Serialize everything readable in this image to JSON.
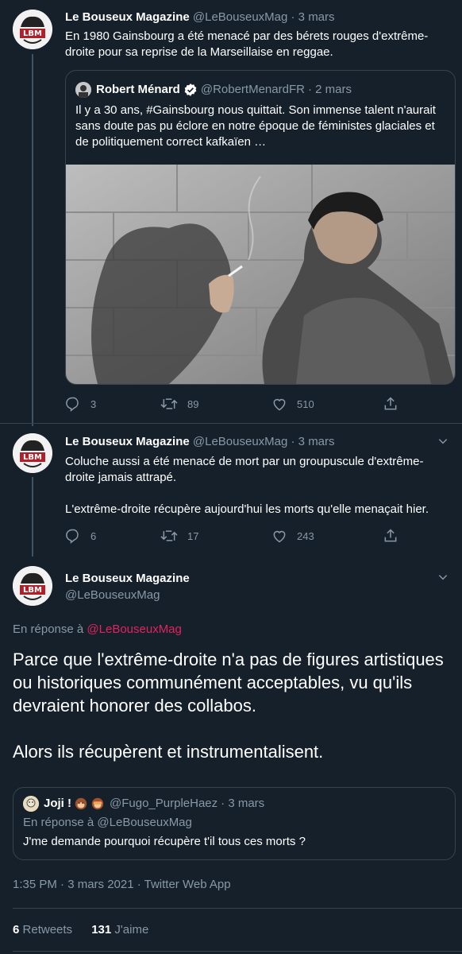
{
  "tweet1": {
    "name": "Le Bouseux Magazine",
    "handle": "@LeBouseuxMag",
    "date": "· 3 mars",
    "text": "En 1980 Gainsbourg a été menacé par des bérets rouges d'extrême-droite pour sa reprise de la Marseillaise en reggae.",
    "quote": {
      "name": "Robert Ménard",
      "handle": "@RobertMenardFR",
      "date": "· 2 mars",
      "text": "Il y a 30 ans, #Gainsbourg nous quittait. Son immense talent n'aurait sans doute pas pu éclore en notre époque de féministes glaciales et de politiquement correct kafkaïen …"
    },
    "replies": "3",
    "retweets": "89",
    "likes": "510"
  },
  "tweet2": {
    "name": "Le Bouseux Magazine",
    "handle": "@LeBouseuxMag",
    "date": "· 3 mars",
    "text1": "Coluche aussi a été menacé de mort par un groupuscule d'extrême-droite jamais attrapé.",
    "text2": "L'extrême-droite récupère aujourd'hui les morts qu'elle menaçait hier.",
    "replies": "6",
    "retweets": "17",
    "likes": "243"
  },
  "main_tweet": {
    "name": "Le Bouseux Magazine",
    "handle": "@LeBouseuxMag",
    "reply_prefix": "En réponse à ",
    "reply_handle": "@LeBouseuxMag",
    "text1": "Parce que l'extrême-droite n'a pas de figures artistiques ou historiques communément acceptables, vu qu'ils devraient honorer des collabos.",
    "text2": "Alors ils récupèrent et instrumentalisent.",
    "quote": {
      "name": "Joji !",
      "handle": "@Fugo_PurpleHaez",
      "date": "· 3 mars",
      "reply_prefix": "En réponse à ",
      "reply_handle": "@LeBouseuxMag",
      "text": "J'me demande pourquoi récupère t'il tous ces morts ?"
    },
    "meta": "1:35 PM · 3 mars 2021 · Twitter Web App",
    "retweets_count": "6",
    "retweets_label": "Retweets",
    "likes_count": "131",
    "likes_label": "J'aime"
  },
  "avatar_text": "LBM",
  "colors": {
    "background": "#15202b",
    "muted": "#8899a6",
    "border": "#38444d",
    "link": "#e0245e",
    "verified": "#1da1f2"
  }
}
